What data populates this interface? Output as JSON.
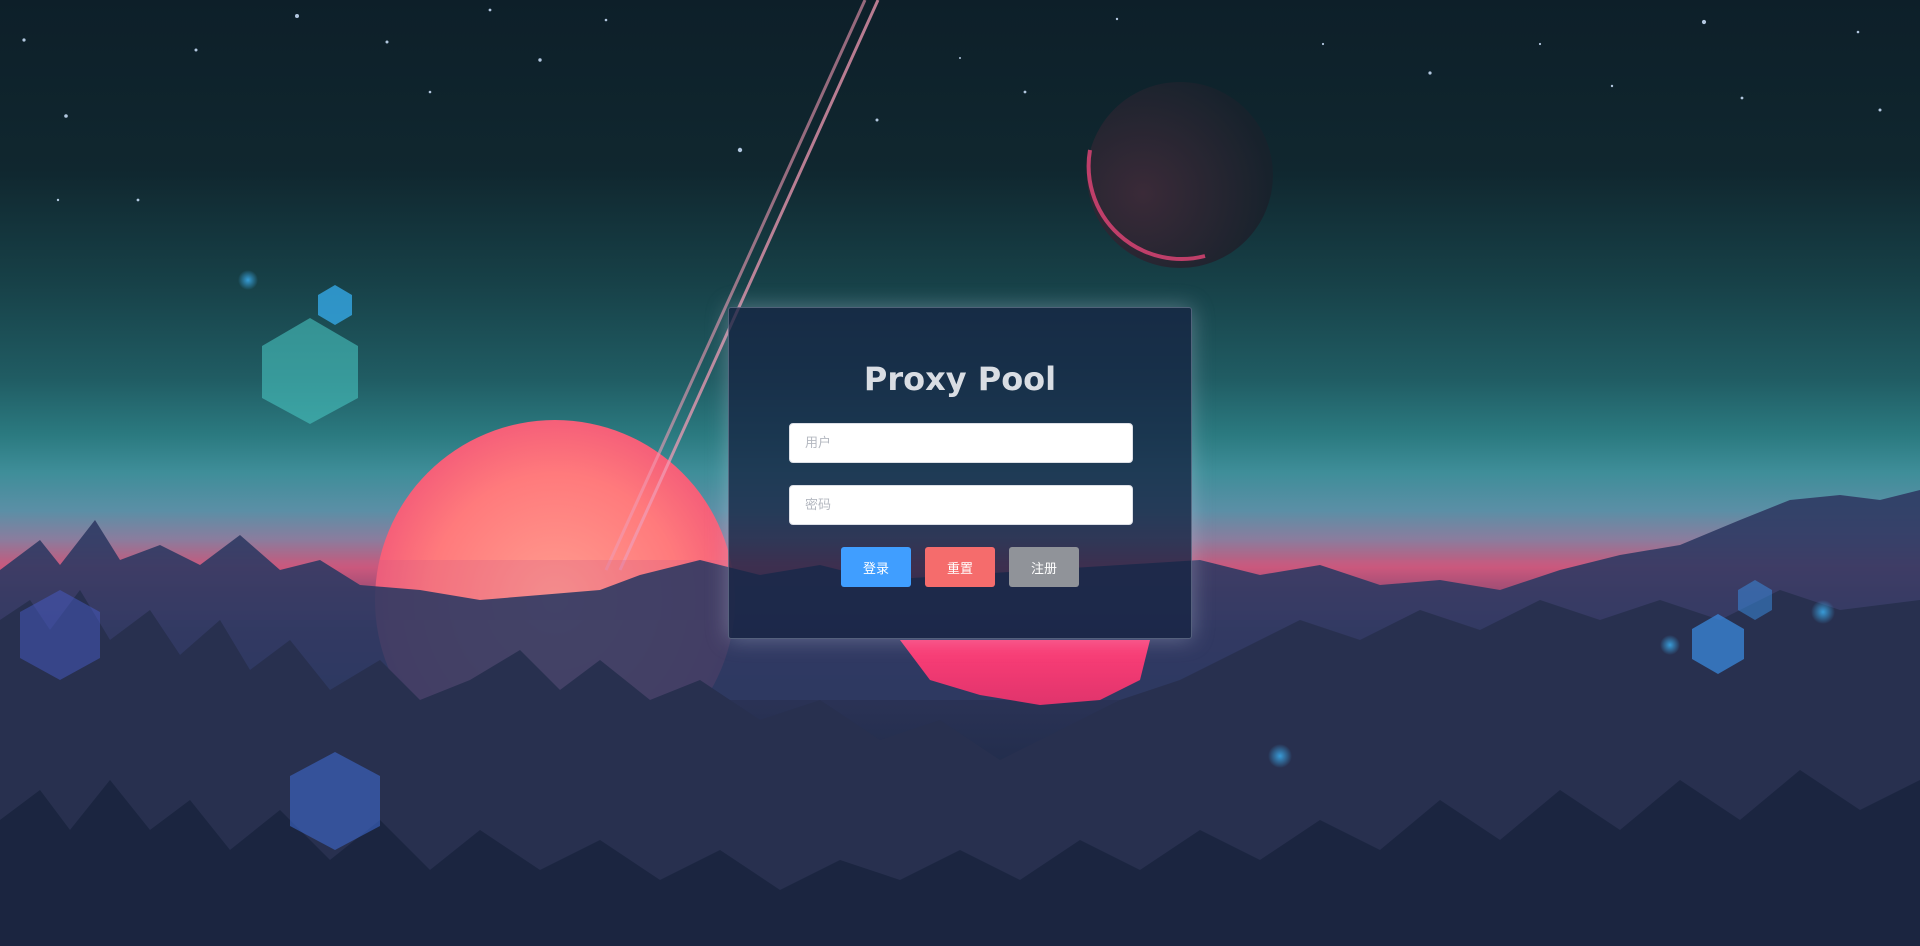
{
  "login": {
    "title": "Proxy Pool",
    "username_placeholder": "用户",
    "password_placeholder": "密码",
    "login_label": "登录",
    "reset_label": "重置",
    "register_label": "注册"
  },
  "colors": {
    "login_button": "#409eff",
    "reset_button": "#f56c6c",
    "register_button": "#909399"
  }
}
